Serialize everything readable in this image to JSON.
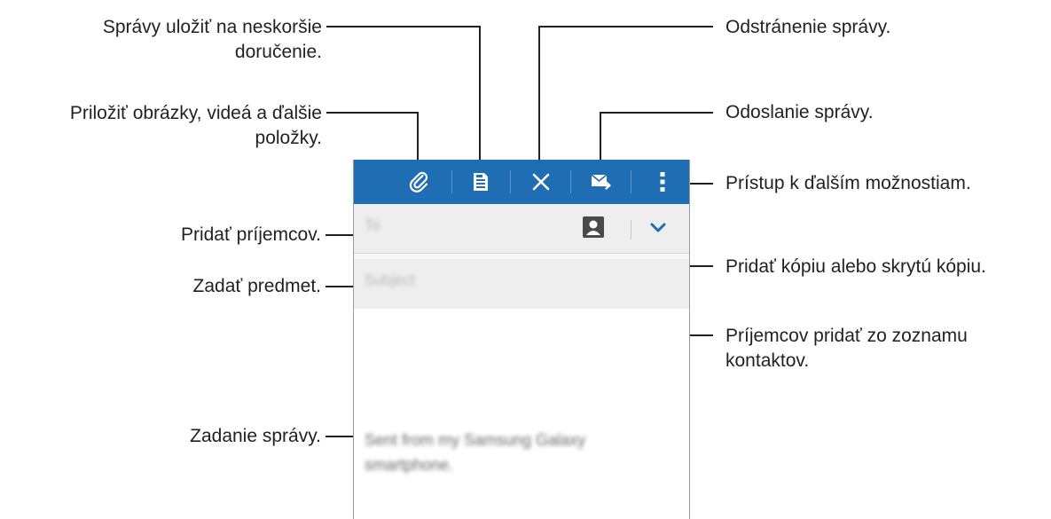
{
  "callouts": {
    "save_draft": [
      "Správy uložiť na neskoršie",
      "doručenie."
    ],
    "attach": [
      "Priložiť obrázky, videá a ďalšie",
      "položky."
    ],
    "add_recipients": "Pridať príjemcov.",
    "subject": "Zadať predmet.",
    "compose": "Zadanie správy.",
    "delete": "Odstránenie správy.",
    "send": "Odoslanie správy.",
    "more_options": "Prístup k ďalším možnostiam.",
    "cc_bcc": "Pridať kópiu alebo skrytú kópiu.",
    "contacts": [
      "Príjemcov pridať zo zoznamu",
      "kontaktov."
    ]
  },
  "compose": {
    "to_placeholder": "To",
    "subject_placeholder": "Subject",
    "signature": "Sent from my Samsung Galaxy smartphone."
  },
  "icons": [
    "paperclip-icon",
    "save-draft-icon",
    "close-icon",
    "send-icon",
    "overflow-menu-icon",
    "contact-icon",
    "chevron-down-icon"
  ],
  "colors": {
    "action_bar": "#1f6db2",
    "field_bg": "#eeeeee",
    "chevron": "#1f6db2"
  }
}
